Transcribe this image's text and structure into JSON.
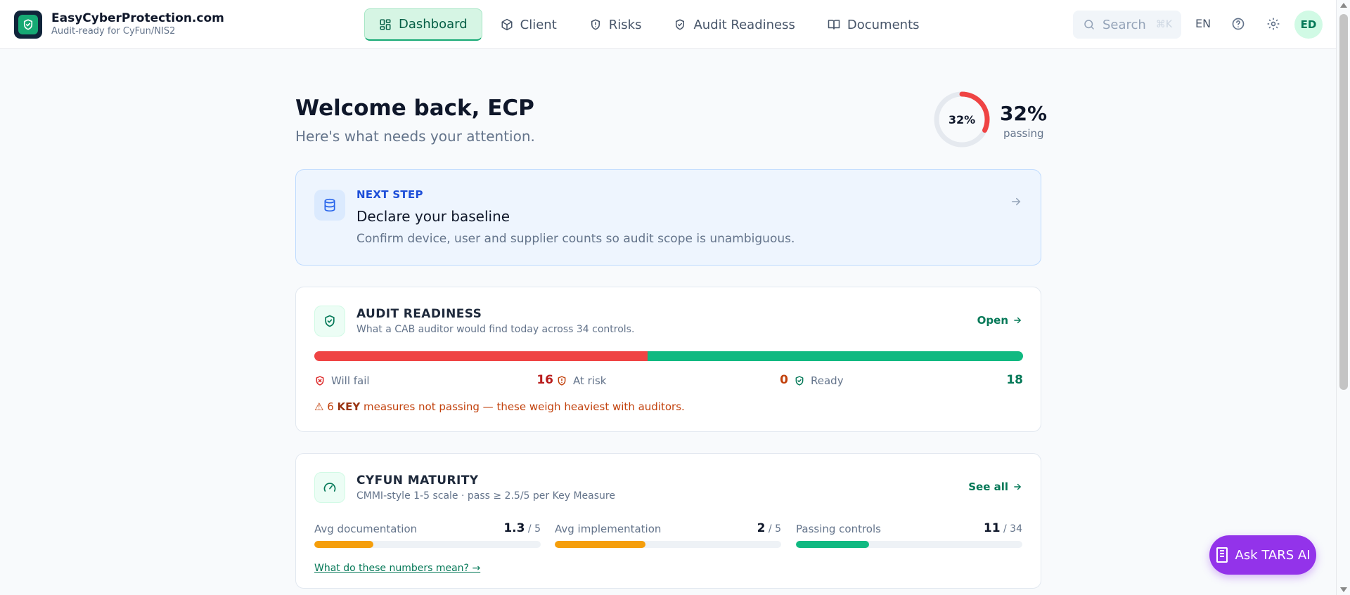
{
  "brand": {
    "name": "EasyCyberProtection.com",
    "tagline": "Audit-ready for CyFun/NIS2"
  },
  "nav": [
    {
      "label": "Dashboard",
      "icon": "grid-icon",
      "active": true
    },
    {
      "label": "Client",
      "icon": "box-icon"
    },
    {
      "label": "Risks",
      "icon": "shield-alert-icon"
    },
    {
      "label": "Audit Readiness",
      "icon": "shield-check-icon"
    },
    {
      "label": "Documents",
      "icon": "book-icon"
    }
  ],
  "header": {
    "search_placeholder": "Search",
    "search_shortcut": "⌘K",
    "language": "EN",
    "avatar_initials": "ED"
  },
  "welcome": {
    "title": "Welcome back, ECP",
    "subtitle": "Here's what needs your attention.",
    "ring_value": "32%",
    "passing_value": "32%",
    "passing_label": "passing",
    "passing_fraction": 0.32
  },
  "next_step": {
    "eyebrow": "NEXT STEP",
    "title": "Declare your baseline",
    "description": "Confirm device, user and supplier counts so audit scope is unambiguous."
  },
  "audit": {
    "title": "AUDIT READINESS",
    "subtitle": "What a CAB auditor would find today across 34 controls.",
    "link": "Open",
    "will_fail_label": "Will fail",
    "will_fail": "16",
    "at_risk_label": "At risk",
    "at_risk": "0",
    "ready_label": "Ready",
    "ready": "18",
    "warn_prefix": "⚠ 6 ",
    "warn_key": "KEY",
    "warn_suffix": " measures not passing — these weigh heaviest with auditors."
  },
  "cyfun": {
    "title": "CYFUN MATURITY",
    "subtitle": "CMMI-style 1-5 scale · pass ≥ 2.5/5 per Key Measure",
    "link": "See all",
    "metrics": [
      {
        "label": "Avg documentation",
        "value": "1.3",
        "den": " / 5",
        "fraction": 0.26
      },
      {
        "label": "Avg implementation",
        "value": "2",
        "den": " / 5",
        "fraction": 0.4
      },
      {
        "label": "Passing controls",
        "value": "11",
        "den": " / 34",
        "fraction": 0.324
      }
    ],
    "explain_link": "What do these numbers mean? →"
  },
  "tars_button": "Ask TARS AI",
  "colors": {
    "accent": "#16a974",
    "fail": "#ef4444",
    "risk": "#f59e0b",
    "ready": "#10b981",
    "bar_amber": "#f59e0b",
    "bar_green": "#10b981",
    "tars": "#9333ea"
  }
}
